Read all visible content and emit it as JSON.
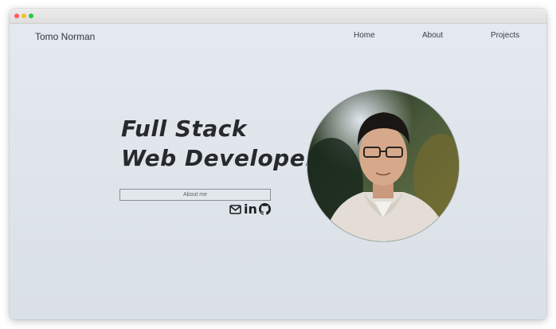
{
  "nav": {
    "brand": "Tomo Norman",
    "links": [
      "Home",
      "About",
      "Projects"
    ]
  },
  "hero": {
    "line1": "Full Stack",
    "line2": "Web Developer",
    "button_label": "About me"
  },
  "social": [
    "mail-icon",
    "linkedin-icon",
    "github-icon"
  ],
  "social_text": {
    "linkedin": "in"
  },
  "colors": {
    "background_top": "#e5eaf0",
    "background_bottom": "#d9e0e6",
    "text": "#27292d"
  }
}
